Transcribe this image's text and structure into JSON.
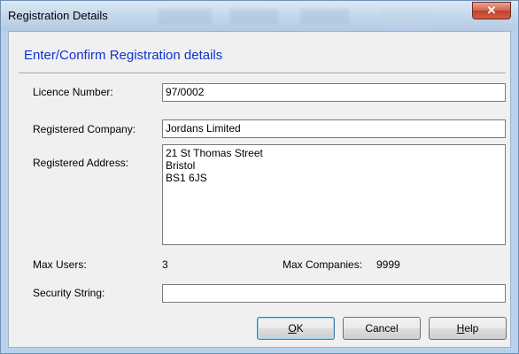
{
  "window": {
    "title": "Registration Details",
    "close_glyph": "✕"
  },
  "heading": "Enter/Confirm Registration details",
  "licence": {
    "label": "Licence Number:",
    "value": "97/0002"
  },
  "company": {
    "label": "Registered Company:",
    "value": "Jordans Limited"
  },
  "address": {
    "label": "Registered Address:",
    "value": "21 St Thomas Street\nBristol\nBS1 6JS"
  },
  "max_users": {
    "label": "Max Users:",
    "value": "3"
  },
  "max_companies": {
    "label": "Max Companies:",
    "value": "9999"
  },
  "security": {
    "label": "Security String:",
    "value": ""
  },
  "buttons": {
    "ok": {
      "first": "O",
      "rest": "K"
    },
    "cancel": {
      "label": "Cancel"
    },
    "help": {
      "first": "H",
      "rest": "elp"
    }
  },
  "icons": {
    "close": "close-icon"
  },
  "colors": {
    "heading": "#1133cc",
    "close_button": "#c2412a",
    "title_bar": "#c3d6ea"
  }
}
